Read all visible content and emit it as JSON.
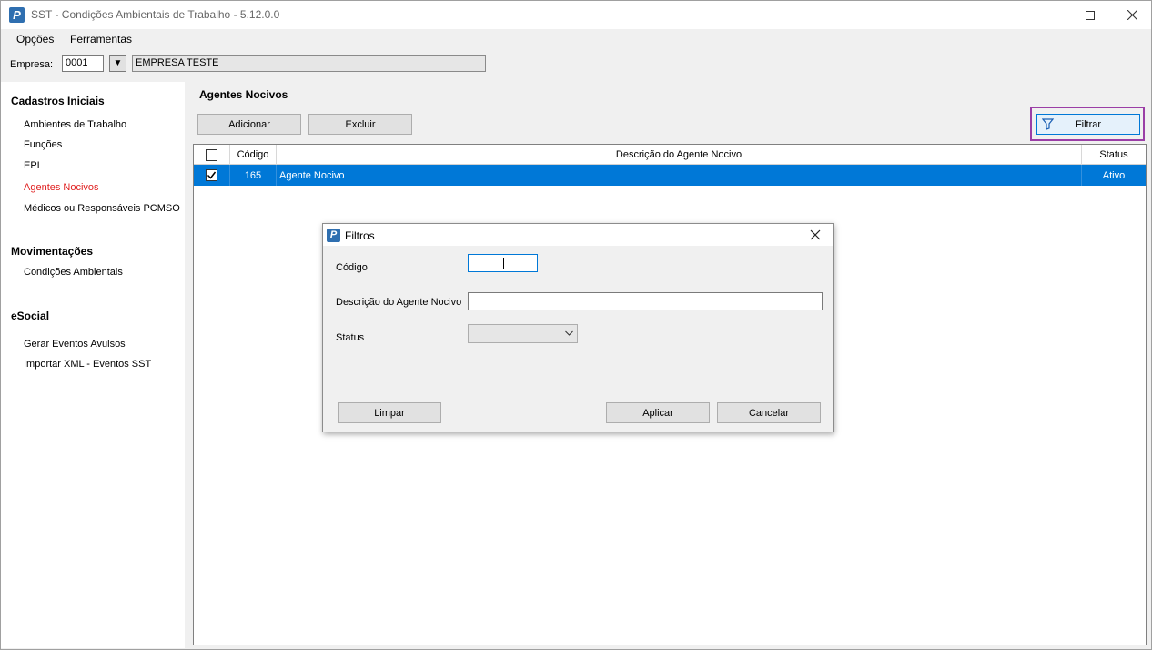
{
  "window": {
    "title": "SST - Condições Ambientais de Trabalho - 5.12.0.0",
    "app_icon_letter": "P"
  },
  "menu": {
    "items": [
      "Opções",
      "Ferramentas"
    ]
  },
  "company": {
    "label": "Empresa:",
    "code": "0001",
    "dropdown_glyph": "▼",
    "name": "EMPRESA TESTE"
  },
  "sidebar": {
    "sections": [
      {
        "title": "Cadastros Iniciais",
        "items": [
          "Ambientes de Trabalho",
          "Funções",
          "EPI",
          "Agentes Nocivos",
          "Médicos ou Responsáveis PCMSO"
        ]
      },
      {
        "title": "Movimentações",
        "items": [
          "Condições Ambientais"
        ]
      },
      {
        "title": "eSocial",
        "items": [
          "Gerar Eventos Avulsos",
          "Importar XML - Eventos SST"
        ]
      }
    ],
    "active_item": "Agentes Nocivos",
    "active_color": "#e02020"
  },
  "main": {
    "title": "Agentes Nocivos",
    "buttons": {
      "add": "Adicionar",
      "delete": "Excluir",
      "filter": "Filtrar"
    },
    "grid": {
      "columns": [
        "",
        "Código",
        "Descrição do Agente Nocivo",
        "Status"
      ],
      "rows": [
        {
          "checked": true,
          "code": "165",
          "description": "Agente Nocivo",
          "status": "Ativo"
        }
      ],
      "selected_color": "#0078d7"
    }
  },
  "dialog": {
    "title": "Filtros",
    "fields": {
      "code_label": "Código",
      "code_value": "",
      "desc_label": "Descrição do Agente Nocivo",
      "desc_value": "",
      "status_label": "Status",
      "status_value": ""
    },
    "buttons": {
      "clear": "Limpar",
      "apply": "Aplicar",
      "cancel": "Cancelar"
    }
  },
  "highlight_color": "#9b3ea6"
}
